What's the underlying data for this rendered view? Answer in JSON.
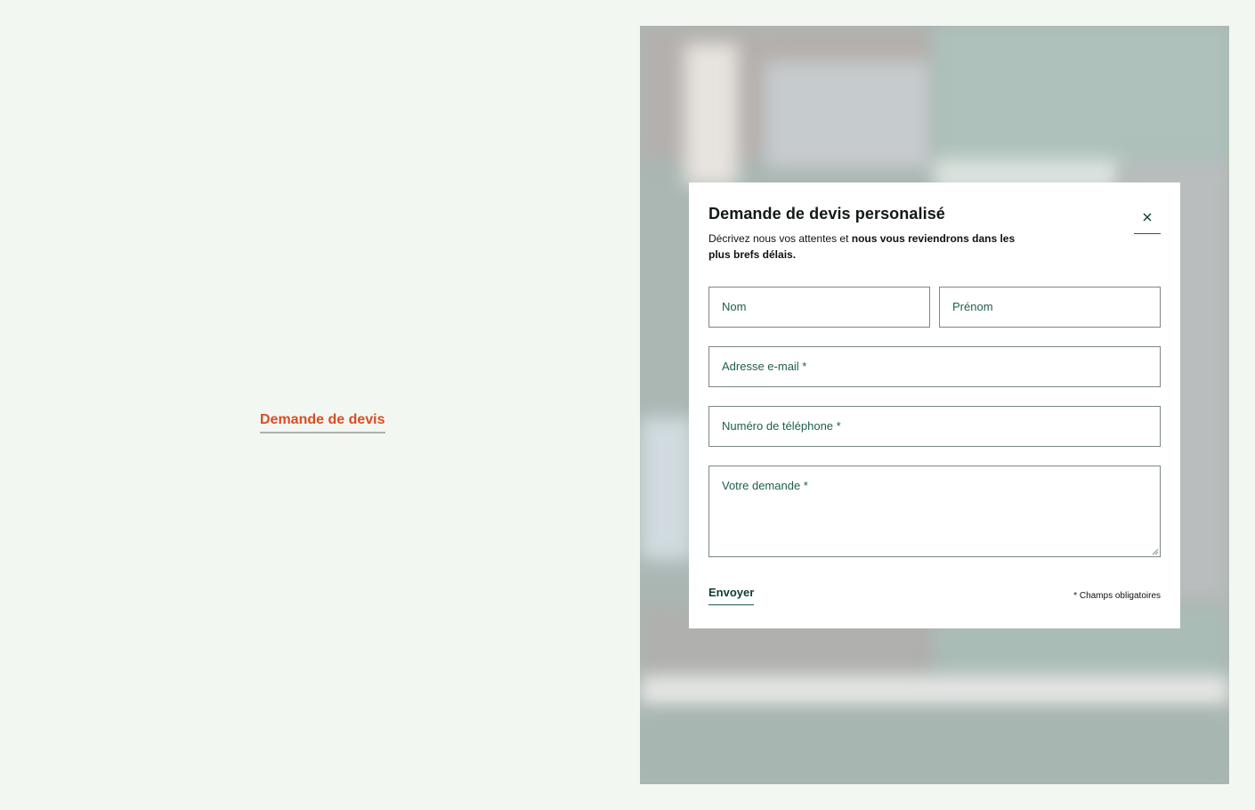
{
  "page": {
    "trigger_link_label": "Demande de devis"
  },
  "modal": {
    "title": "Demande de devis personalisé",
    "description_plain": "Décrivez nous vos attentes et ",
    "description_bold": "nous vous reviendrons dans les plus brefs délais.",
    "close_icon": "close-icon",
    "fields": {
      "nom": {
        "placeholder": "Nom",
        "value": ""
      },
      "prenom": {
        "placeholder": "Prénom",
        "value": ""
      },
      "email": {
        "placeholder": "Adresse e-mail *",
        "value": ""
      },
      "phone": {
        "placeholder": "Numéro de téléphone *",
        "value": ""
      },
      "demande": {
        "placeholder": "Votre demande *",
        "value": ""
      }
    },
    "submit_label": "Envoyer",
    "required_note": "* Champs obligatoires"
  },
  "colors": {
    "page_background": "#f3f7f1",
    "accent_orange": "#d94c26",
    "accent_green": "#1f5e4c",
    "modal_background": "#ffffff"
  }
}
